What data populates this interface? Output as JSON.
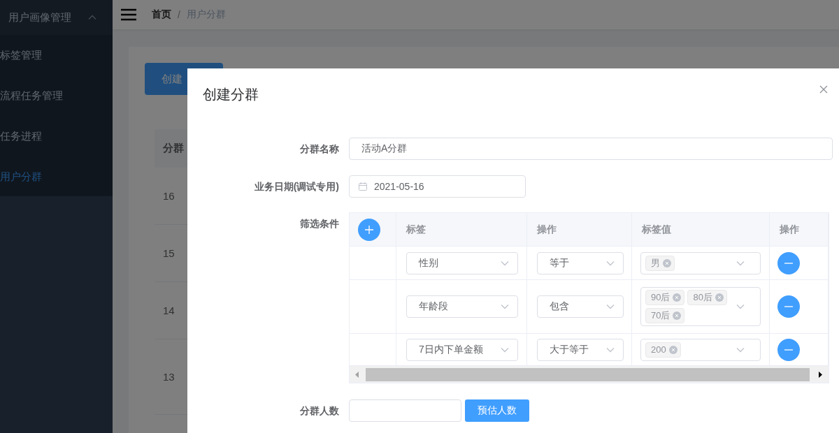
{
  "sidebar": {
    "menu": {
      "label": "用户画像管理",
      "expanded": true
    },
    "items": [
      {
        "label": "标签管理",
        "selected": false
      },
      {
        "label": "流程任务管理",
        "selected": false
      },
      {
        "label": "任务进程",
        "selected": false
      },
      {
        "label": "用户分群",
        "selected": true
      }
    ]
  },
  "header": {
    "breadcrumb": [
      "首页",
      "用户分群"
    ],
    "separator": "/"
  },
  "page": {
    "create_button": "创建",
    "table": {
      "columns": [
        "分群"
      ],
      "rows": [
        "16",
        "15",
        "14",
        "13"
      ]
    }
  },
  "dialog": {
    "title": "创建分群",
    "name": {
      "label": "分群名称",
      "value": "活动A分群"
    },
    "date": {
      "label": "业务日期(调试专用)",
      "value": "2021-05-16"
    },
    "filter": {
      "label": "筛选条件",
      "columns": [
        "标签",
        "操作",
        "标签值",
        "操作"
      ],
      "rows": [
        {
          "tag": "性别",
          "op": "等于",
          "values": [
            "男"
          ]
        },
        {
          "tag": "年龄段",
          "op": "包含",
          "values": [
            "90后",
            "80后",
            "70后"
          ]
        },
        {
          "tag": "7日内下单金额",
          "op": "大于等于",
          "values": [
            "200"
          ]
        }
      ]
    },
    "count": {
      "label": "分群人数",
      "button": "预估人数"
    }
  }
}
